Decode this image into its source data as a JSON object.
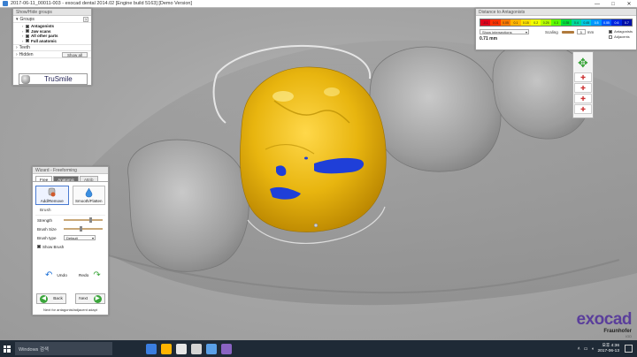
{
  "window": {
    "title": "2017-06-11_00011-003 - exocad dental 2014.02 [Engine build 5163] [Demo Version]",
    "minimize": "—",
    "maximize": "□",
    "close": "✕"
  },
  "groups_panel": {
    "title": "Show/Hide groups",
    "groups_label": "Groups",
    "help": "?",
    "items": [
      {
        "label": "Antagonists",
        "checked": true
      },
      {
        "label": "Jaw scans",
        "checked": true
      },
      {
        "label": "All other parts",
        "checked": true
      },
      {
        "label": "Full anatomic",
        "checked": true
      }
    ],
    "teeth_label": "Teeth",
    "hidden_label": "Hidden",
    "show_all": "Show all",
    "trusmile": "TruSmile"
  },
  "distance_panel": {
    "title": "Distance to Antagonists",
    "scale_values": [
      "-0.1",
      "0.01",
      "0.05",
      "0.1",
      "0.15",
      "0.2",
      "0.25",
      "0.3",
      "0.35",
      "0.4",
      "0.45",
      "0.5",
      "0.55",
      "0.6",
      "0.7"
    ],
    "scale_colors": [
      "#e0001b",
      "#ff3300",
      "#ff7a00",
      "#ffb400",
      "#ffe100",
      "#f0ff00",
      "#b4ff00",
      "#5cff00",
      "#00e03a",
      "#00d89a",
      "#00c8e0",
      "#0096ff",
      "#0058ff",
      "#0026e0",
      "#0010a8"
    ],
    "mode": "Show intersections",
    "scaling_label": "Scaling",
    "scaling_value": "5",
    "unit": "mm",
    "antagonists": "Antagonists",
    "adjacents": "Adjacents",
    "current_value": "0.71 mm"
  },
  "nav": {
    "arrows": "✥",
    "views": [
      "✚",
      "✚",
      "✚",
      "✚"
    ]
  },
  "wizard": {
    "title": "Wizard - Freeforming",
    "tabs": [
      "Free",
      "Anatomic",
      "Attrib"
    ],
    "tools": [
      "Add/Remove",
      "Smooth/Flatten"
    ],
    "brush_title": "Brush",
    "strength_label": "Strength",
    "strength_value": 0.7,
    "size_label": "Brush Size",
    "size_value": 0.45,
    "type_label": "Brush type",
    "type_value": "Default",
    "show_brush": "Show Brush",
    "show_brush_checked": true,
    "undo": "Undo",
    "redo": "Redo",
    "back": "Back",
    "next": "Next",
    "back_symbol": "◀",
    "next_symbol": "▶",
    "next_hint": "Next for antagonist/adjacent adapt"
  },
  "logo": {
    "word": "exocad",
    "brand": "Fraunhofer",
    "subtitle": "IGD"
  },
  "taskbar": {
    "search_placeholder": "Windows 검색",
    "time": "오후 4:36",
    "date": "2017-06-13",
    "icons": [
      "#3b7ee0",
      "#ffb400",
      "#e6e6e6",
      "#d4d4d4",
      "#5aa0e8",
      "#8a63c2"
    ]
  }
}
